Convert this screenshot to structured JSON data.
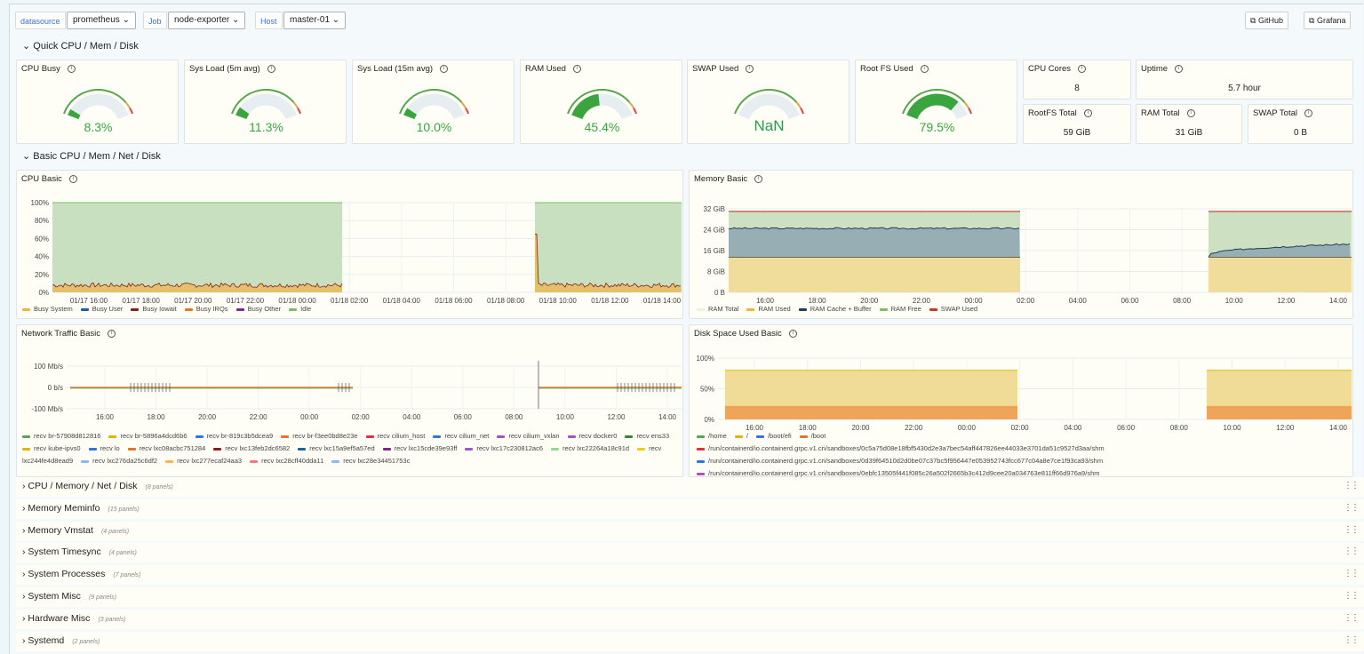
{
  "vars": {
    "datasource_label": "datasource",
    "datasource_value": "prometheus",
    "job_label": "Job",
    "job_value": "node-exporter",
    "host_label": "Host",
    "host_value": "master-01"
  },
  "links": {
    "github": "GitHub",
    "grafana": "Grafana"
  },
  "rows": {
    "quick": "Quick CPU / Mem / Disk",
    "basic": "Basic CPU / Mem / Net / Disk"
  },
  "gauges": [
    {
      "title": "CPU Busy",
      "value": "8.3%",
      "level": 0.083
    },
    {
      "title": "Sys Load (5m avg)",
      "value": "11.3%",
      "level": 0.113
    },
    {
      "title": "Sys Load (15m avg)",
      "value": "10.0%",
      "level": 0.1
    },
    {
      "title": "RAM Used",
      "value": "45.4%",
      "level": 0.454
    },
    {
      "title": "SWAP Used",
      "value": "NaN",
      "level": 0
    },
    {
      "title": "Root FS Used",
      "value": "79.5%",
      "level": 0.795
    }
  ],
  "stats": {
    "cpu_cores": {
      "title": "CPU Cores",
      "value": "8"
    },
    "uptime": {
      "title": "Uptime",
      "value": "5.7 hour"
    },
    "rootfs_total": {
      "title": "RootFS Total",
      "value": "59 GiB"
    },
    "ram_total": {
      "title": "RAM Total",
      "value": "31 GiB"
    },
    "swap_total": {
      "title": "SWAP Total",
      "value": "0 B"
    }
  },
  "chart_data": [
    {
      "title": "CPU Basic",
      "type": "area",
      "y_ticks": [
        "100%",
        "80%",
        "60%",
        "40%",
        "20%",
        "0%"
      ],
      "x_ticks": [
        "01/17 16:00",
        "01/17 18:00",
        "01/17 20:00",
        "01/17 22:00",
        "01/18 00:00",
        "01/18 02:00",
        "01/18 04:00",
        "01/18 06:00",
        "01/18 08:00",
        "01/18 10:00",
        "01/18 12:00",
        "01/18 14:00"
      ],
      "legend": [
        {
          "name": "Busy System",
          "color": "#e9b53c"
        },
        {
          "name": "Busy User",
          "color": "#1f60a0"
        },
        {
          "name": "Busy Iowait",
          "color": "#8a1c1c"
        },
        {
          "name": "Busy IRQs",
          "color": "#e07a1f"
        },
        {
          "name": "Busy Other",
          "color": "#7b2a8a"
        },
        {
          "name": "Idle",
          "color": "#7fba6a"
        }
      ],
      "ylim": [
        0,
        100
      ],
      "data_windows": [
        [
          "01/17 14:30",
          "01/18 01:40"
        ],
        [
          "01/18 09:00",
          "01/18 14:40"
        ]
      ],
      "series": [
        {
          "name": "Idle",
          "approx_value": 92
        },
        {
          "name": "Busy System",
          "approx_value": 8
        }
      ]
    },
    {
      "title": "Memory Basic",
      "type": "area",
      "y_ticks": [
        "32 GiB",
        "24 GiB",
        "16 GiB",
        "8 GiB",
        "0 B"
      ],
      "x_ticks": [
        "16:00",
        "18:00",
        "20:00",
        "22:00",
        "00:00",
        "02:00",
        "04:00",
        "06:00",
        "08:00",
        "10:00",
        "12:00",
        "14:00"
      ],
      "legend": [
        {
          "name": "RAM Total",
          "color": "#f0eedc"
        },
        {
          "name": "RAM Used",
          "color": "#e9b53c"
        },
        {
          "name": "RAM Cache + Buffer",
          "color": "#1f3d5a"
        },
        {
          "name": "RAM Free",
          "color": "#7fba6a"
        },
        {
          "name": "SWAP Used",
          "color": "#c0392b"
        }
      ],
      "ylim": [
        0,
        32
      ],
      "data_windows": [
        [
          "14:30",
          "01:40"
        ],
        [
          "09:00",
          "14:40"
        ]
      ],
      "series": [
        {
          "name": "RAM Used",
          "values_gib": [
            13.5,
            13.5
          ]
        },
        {
          "name": "RAM Cache + Buffer",
          "values_gib": [
            24.5,
            18.5
          ]
        },
        {
          "name": "RAM Total",
          "values_gib": [
            31,
            31
          ]
        }
      ]
    },
    {
      "title": "Network Traffic Basic",
      "type": "line",
      "y_ticks": [
        "100 Mb/s",
        "0 b/s",
        "-100 Mb/s"
      ],
      "x_ticks": [
        "16:00",
        "18:00",
        "20:00",
        "22:00",
        "00:00",
        "02:00",
        "04:00",
        "06:00",
        "08:00",
        "10:00",
        "12:00",
        "14:00"
      ],
      "legend": [
        {
          "name": "recv br-57908d812816",
          "color": "#56a64b"
        },
        {
          "name": "recv br-5896a4dcd6b6",
          "color": "#e0b400"
        },
        {
          "name": "recv br-819c3b5dcea9",
          "color": "#3274d9"
        },
        {
          "name": "recv br-f3ee0bd8e23e",
          "color": "#e0752d"
        },
        {
          "name": "recv cilium_host",
          "color": "#e02f44"
        },
        {
          "name": "recv cilium_net",
          "color": "#3274d9"
        },
        {
          "name": "recv cilium_vxlan",
          "color": "#a352cc"
        },
        {
          "name": "recv docker0",
          "color": "#a352cc"
        },
        {
          "name": "recv ens33",
          "color": "#37872d"
        },
        {
          "name": "recv kube-ipvs0",
          "color": "#e0b400"
        },
        {
          "name": "recv lo",
          "color": "#3274d9"
        },
        {
          "name": "recv lxc08acbc751284",
          "color": "#e0752d"
        },
        {
          "name": "recv lxc13feb2dc6582",
          "color": "#8a1c1c"
        },
        {
          "name": "recv lxc15a9ef5a57ed",
          "color": "#1f60a0"
        },
        {
          "name": "recv lxc15cde39e93ff",
          "color": "#7b2a8a"
        },
        {
          "name": "recv lxc17c230812ac6",
          "color": "#a352cc"
        },
        {
          "name": "recv lxc22264a18c91d",
          "color": "#96d98d"
        },
        {
          "name": "recv lxc244fe4d8ead9",
          "color": "#f2cc0c"
        },
        {
          "name": "recv lxc276da25c6df2",
          "color": "#8ab8ff"
        },
        {
          "name": "recv lxc277ecaf24aa3",
          "color": "#ffb357"
        },
        {
          "name": "recv lxc28cff40dda11",
          "color": "#ff7383"
        },
        {
          "name": "recv lxc28e34451753c",
          "color": "#8ab8ff"
        }
      ],
      "data_windows": [
        [
          "14:30",
          "01:40"
        ],
        [
          "09:00",
          "14:40"
        ]
      ],
      "series": [
        {
          "name": "all",
          "approx_value": 0
        }
      ]
    },
    {
      "title": "Disk Space Used Basic",
      "type": "area",
      "y_ticks": [
        "100%",
        "50%",
        "0%"
      ],
      "x_ticks": [
        "16:00",
        "18:00",
        "20:00",
        "22:00",
        "00:00",
        "02:00",
        "04:00",
        "06:00",
        "08:00",
        "10:00",
        "12:00",
        "14:00"
      ],
      "legend": [
        {
          "name": "/home",
          "color": "#56a64b"
        },
        {
          "name": "/",
          "color": "#e0b400"
        },
        {
          "name": "/boot/efi",
          "color": "#3274d9"
        },
        {
          "name": "/boot",
          "color": "#e0752d"
        },
        {
          "name": "/run/containerd/io.containerd.grpc.v1.cri/sandboxes/0c5a75d08e18fbf5430d2e3a7bec54aff447826ee44033e3701da51c9527d3aa/shm",
          "color": "#e02f44"
        },
        {
          "name": "/run/containerd/io.containerd.grpc.v1.cri/sandboxes/0d39f64510d2d0be07c37bc5f956447e053952743fcc677c04a8e7ce1f93ca93/shm",
          "color": "#3274d9"
        },
        {
          "name": "/run/containerd/io.containerd.grpc.v1.cri/sandboxes/0ebfc13505f441f085c26a502f2665b3c412d9cee20a034763e811ff66d976a9/shm",
          "color": "#a352cc"
        }
      ],
      "ylim": [
        0,
        100
      ],
      "data_windows": [
        [
          "14:30",
          "01:40"
        ],
        [
          "09:00",
          "14:40"
        ]
      ],
      "series": [
        {
          "name": "/",
          "approx_value": 80
        },
        {
          "name": "/boot",
          "approx_value": 22
        }
      ]
    }
  ],
  "collapsed_rows": [
    {
      "title": "CPU / Memory / Net / Disk",
      "count": "(8 panels)"
    },
    {
      "title": "Memory Meminfo",
      "count": "(15 panels)"
    },
    {
      "title": "Memory Vmstat",
      "count": "(4 panels)"
    },
    {
      "title": "System Timesync",
      "count": "(4 panels)"
    },
    {
      "title": "System Processes",
      "count": "(7 panels)"
    },
    {
      "title": "System Misc",
      "count": "(9 panels)"
    },
    {
      "title": "Hardware Misc",
      "count": "(3 panels)"
    },
    {
      "title": "Systemd",
      "count": "(2 panels)"
    }
  ]
}
